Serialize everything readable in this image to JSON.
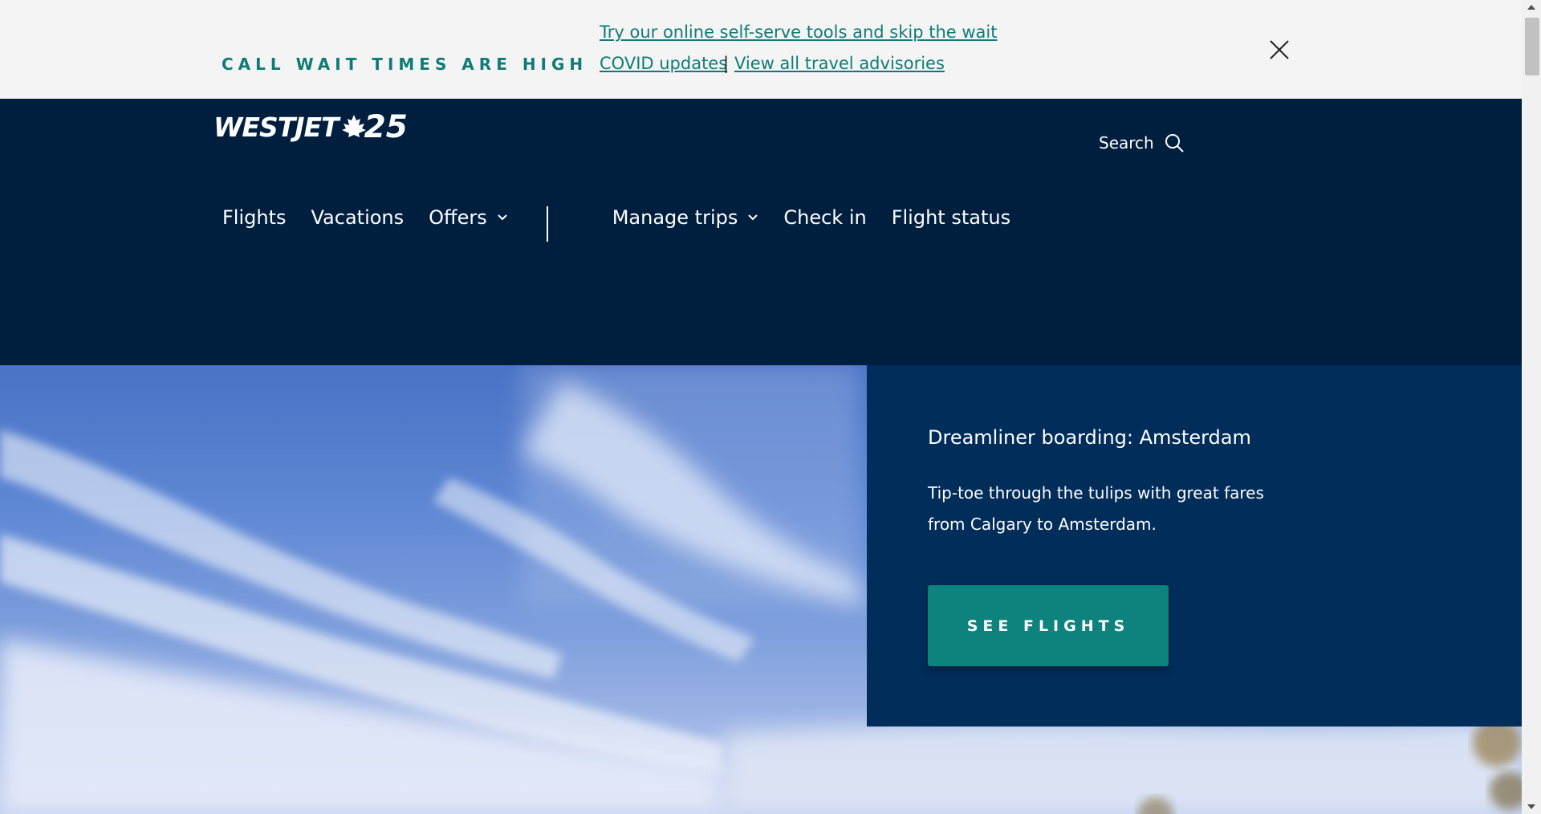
{
  "alert": {
    "heading": "CALL WAIT TIMES ARE HIGH",
    "link_self_serve": "Try our online self-serve tools and skip the wait",
    "link_covid": "COVID updates",
    "separator": "|",
    "link_advisories": "View all travel advisories"
  },
  "header": {
    "logo_text": "WESTJET",
    "logo_number": "25",
    "search_label": "Search",
    "nav": [
      {
        "label": "Flights"
      },
      {
        "label": "Vacations"
      },
      {
        "label": "Offers"
      },
      {
        "label": "Manage trips"
      },
      {
        "label": "Check in"
      },
      {
        "label": "Flight status"
      }
    ]
  },
  "promo": {
    "title": "Dreamliner boarding: Amsterdam",
    "body": "Tip-toe through the tulips with great fares from Calgary to Amsterdam.",
    "button_label": "SEE FLIGHTS"
  },
  "colors": {
    "teal": "#0f7b76",
    "navy": "#001f3f",
    "promo_navy": "#002d5a",
    "button_teal": "#0e827c"
  },
  "icons": {
    "close": "close-icon",
    "search": "search-icon",
    "chevron": "chevron-down-icon",
    "maple_leaf": "maple-leaf-icon"
  }
}
